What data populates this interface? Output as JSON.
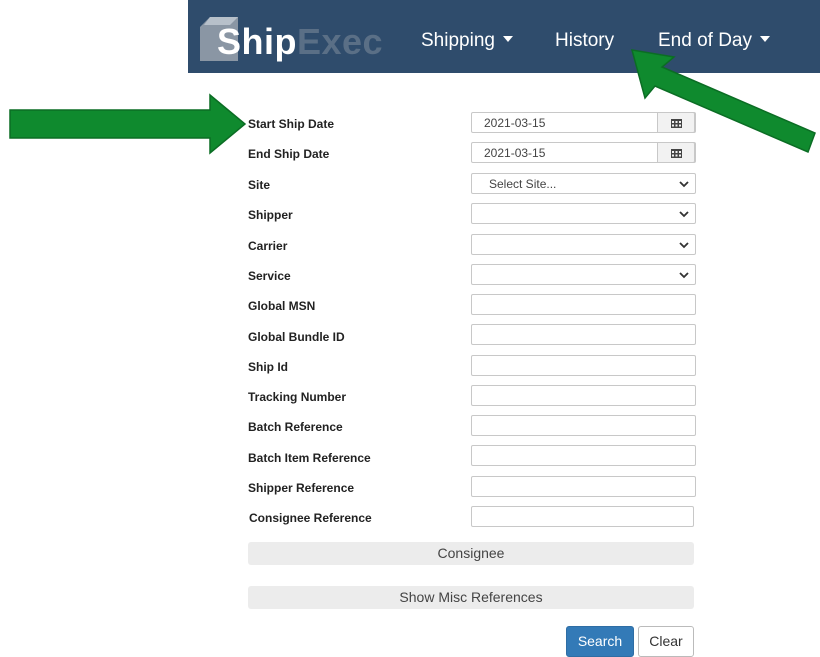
{
  "navbar": {
    "logo": {
      "ship": "Ship",
      "exec": "Exec"
    },
    "items": [
      {
        "label": "Shipping",
        "has_caret": true
      },
      {
        "label": "History",
        "has_caret": false
      },
      {
        "label": "End of Day",
        "has_caret": true
      }
    ]
  },
  "form": {
    "start_ship_date": {
      "label": "Start Ship Date",
      "value": "2021-03-15",
      "icon": "calendar-icon"
    },
    "end_ship_date": {
      "label": "End Ship Date",
      "value": "2021-03-15",
      "icon": "calendar-icon"
    },
    "site": {
      "label": "Site",
      "value": "Select Site..."
    },
    "shipper": {
      "label": "Shipper",
      "value": ""
    },
    "carrier": {
      "label": "Carrier",
      "value": ""
    },
    "service": {
      "label": "Service",
      "value": ""
    },
    "global_msn": {
      "label": "Global MSN",
      "value": ""
    },
    "global_bundle_id": {
      "label": "Global Bundle ID",
      "value": ""
    },
    "ship_id": {
      "label": "Ship Id",
      "value": ""
    },
    "tracking_number": {
      "label": "Tracking Number",
      "value": ""
    },
    "batch_reference": {
      "label": "Batch Reference",
      "value": ""
    },
    "batch_item_reference": {
      "label": "Batch Item Reference",
      "value": ""
    },
    "shipper_reference": {
      "label": "Shipper Reference",
      "value": ""
    },
    "consignee_reference": {
      "label": "Consignee Reference",
      "value": ""
    }
  },
  "sections": {
    "consignee": "Consignee",
    "show_misc_references": "Show Misc References"
  },
  "actions": {
    "search": "Search",
    "clear": "Clear"
  },
  "colors": {
    "navbar_bg": "#2f4c6c",
    "annotation_arrow": "#0f8a2e",
    "primary_button": "#337ab7"
  }
}
